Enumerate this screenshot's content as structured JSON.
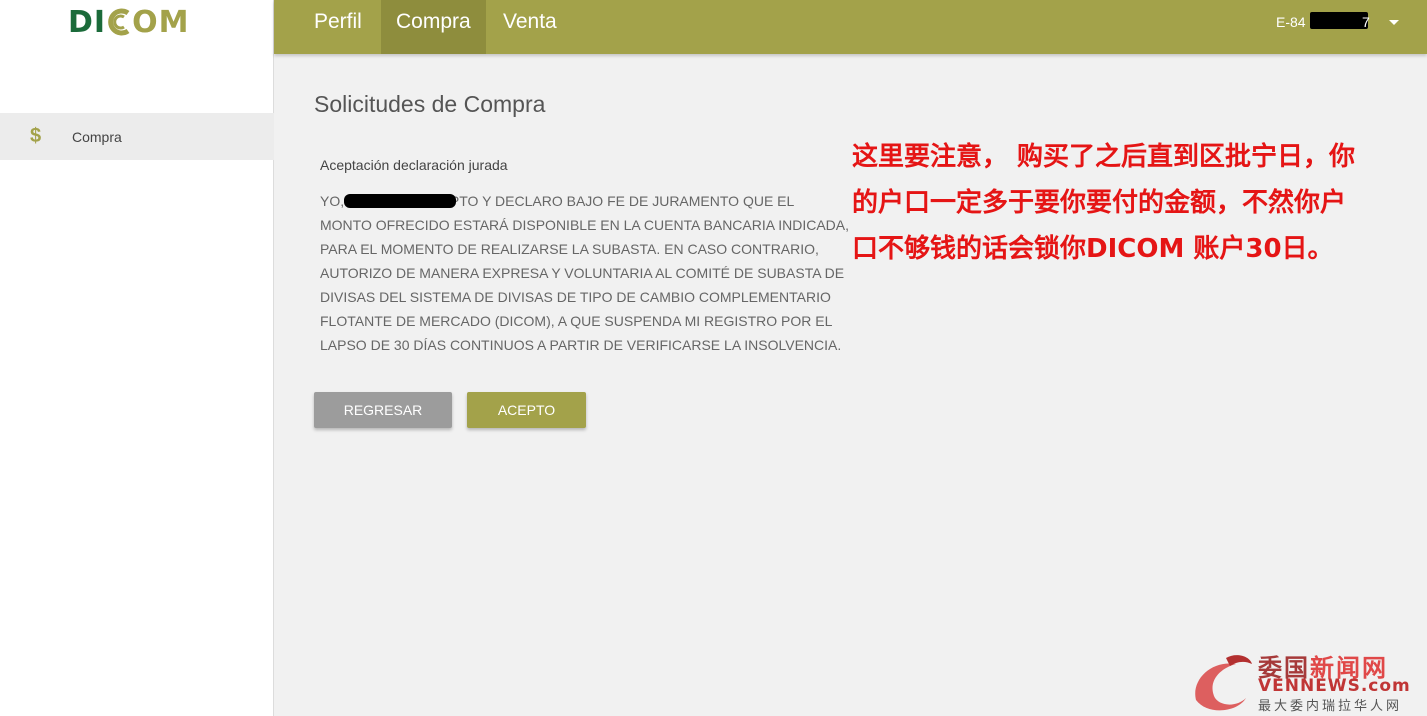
{
  "logo": {
    "part1": "DI",
    "part2": "M"
  },
  "sidebar": {
    "items": [
      {
        "icon": "dollar-icon",
        "label": "Compra"
      }
    ]
  },
  "topbar": {
    "tabs": [
      {
        "label": "Perfil",
        "active": false
      },
      {
        "label": "Compra",
        "active": true
      },
      {
        "label": "Venta",
        "active": false
      }
    ],
    "user_prefix": "E-84",
    "user_suffix": "7"
  },
  "main": {
    "title": "Solicitudes de Compra",
    "declaration_title": "Aceptación declaración jurada",
    "declaration_lines": [
      "YO,                    ACEPTO Y DECLARO BAJO FE DE JURAMENTO QUE EL",
      "MONTO OFRECIDO ESTARÁ DISPONIBLE EN LA CUENTA BANCARIA INDICADA,",
      "PARA EL MOMENTO DE REALIZARSE LA SUBASTA. EN CASO CONTRARIO,",
      "AUTORIZO DE MANERA EXPRESA Y VOLUNTARIA AL COMITÉ DE SUBASTA DE",
      "DIVISAS DEL SISTEMA DE DIVISAS DE TIPO DE CAMBIO COMPLEMENTARIO",
      "FLOTANTE DE MERCADO (DICOM), A QUE SUSPENDA MI REGISTRO POR EL",
      "LAPSO DE 30 DÍAS CONTINUOS A PARTIR DE VERIFICARSE LA INSOLVENCIA."
    ],
    "buttons": {
      "back": "REGRESAR",
      "accept": "ACEPTO"
    }
  },
  "annotation": {
    "lines": [
      "这里要注意， 购买了之后直到区批宁日，你",
      "的户口一定多于要你要付的金额，不然你户",
      "口不够钱的话会锁你DICOM 账户30日。"
    ]
  },
  "watermark": {
    "line1_a": "委国",
    "line1_b": "新闻网",
    "line2": "VENNEWS.com",
    "line3": "最大委内瑞拉华人网"
  },
  "colors": {
    "brand": "#a3a24a",
    "brand_dark": "#8e8d3d",
    "logo_green": "#1b6b3a",
    "annotation": "#e51515"
  }
}
